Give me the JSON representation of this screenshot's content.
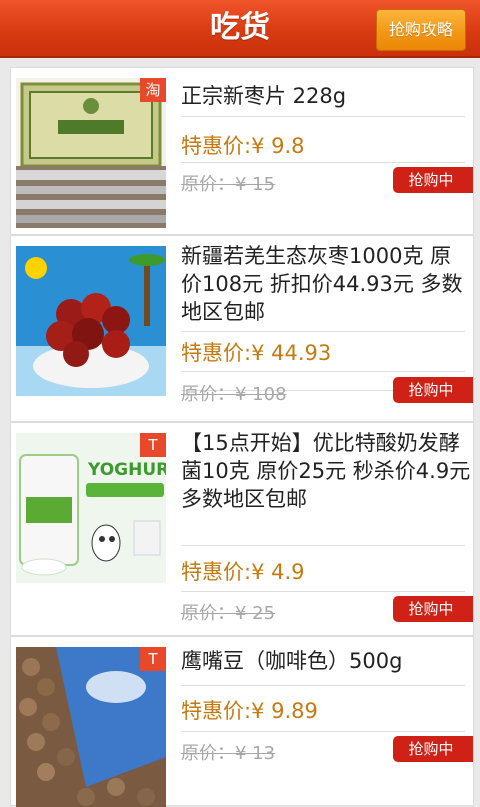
{
  "header": {
    "title": "吃货",
    "guide_button": "抢购攻略"
  },
  "items": [
    {
      "badge": "淘",
      "name": "正宗新枣片 228g",
      "price_label": "特惠价:",
      "price": "¥ 9.8",
      "orig_label": "原价：",
      "orig": "¥ 15",
      "button": "抢购中",
      "image": "packaged-date-slices"
    },
    {
      "badge": "",
      "name": "新疆若羌生态灰枣1000克 原价108元 折扣价44.93元 多数地区包邮",
      "price_label": "特惠价:",
      "price": "¥ 44.93",
      "orig_label": "原价：",
      "orig": "¥ 108",
      "button": "抢购中",
      "image": "red-dates-bowl"
    },
    {
      "badge": "T",
      "name": "【15点开始】优比特酸奶发酵菌10克 原价25元 秒杀价4.9元多数地区包邮",
      "price_label": "特惠价:",
      "price": "¥ 4.9",
      "orig_label": "原价：",
      "orig": "¥ 25",
      "button": "抢购中",
      "image": "yoghurt-starter",
      "image_text": "YOGHURT"
    },
    {
      "badge": "T",
      "name": "鹰嘴豆（咖啡色）500g",
      "price_label": "特惠价:",
      "price": "¥ 9.89",
      "orig_label": "原价：",
      "orig": "¥ 13",
      "button": "抢购中",
      "image": "chickpeas-bag"
    }
  ]
}
